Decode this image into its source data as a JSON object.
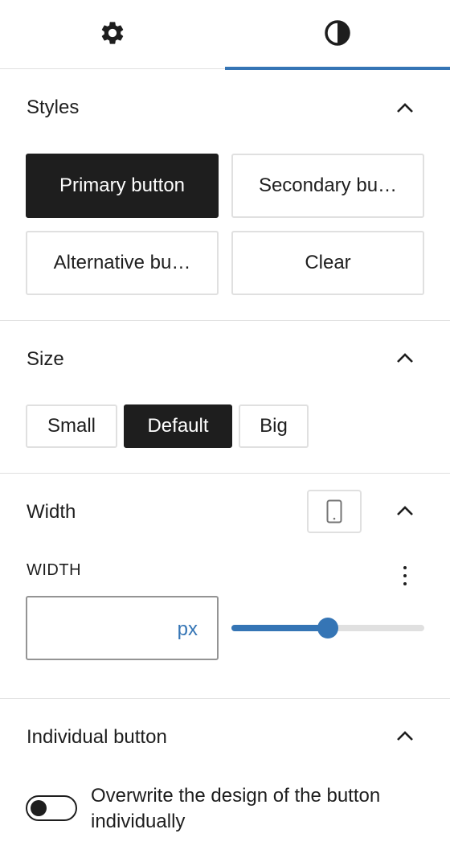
{
  "tabs": [
    {
      "icon": "gear-icon",
      "active": false
    },
    {
      "icon": "half-circle-contrast-icon",
      "active": true
    }
  ],
  "colors": {
    "accent": "#3575b5",
    "dark": "#1e1e1e",
    "border": "#e0e0e0"
  },
  "styles": {
    "title": "Styles",
    "options": [
      "Primary button",
      "Secondary bu…",
      "Alternative bu…",
      "Clear"
    ],
    "selected": "Primary button"
  },
  "size": {
    "title": "Size",
    "options": [
      "Small",
      "Default",
      "Big"
    ],
    "selected": "Default"
  },
  "width": {
    "title": "Width",
    "label": "WIDTH",
    "value": "",
    "unit": "px",
    "slider_fraction": 0.5
  },
  "individual": {
    "title": "Individual button",
    "toggle_label": "Overwrite the design of the button individually",
    "toggle_on": false
  }
}
